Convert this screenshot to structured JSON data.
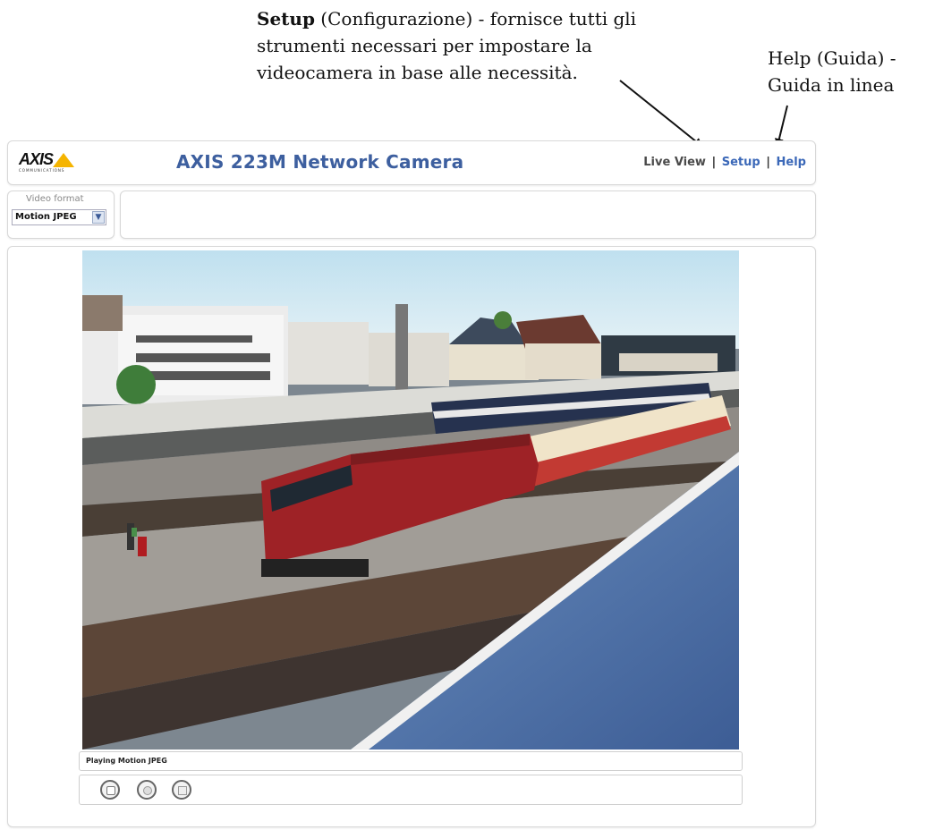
{
  "annotations": {
    "setup_bold": "Setup",
    "setup_rest": " (Configurazione) - fornisce tutti gli",
    "setup_line2": "strumenti necessari per impostare la",
    "setup_line3": "videocamera in base alle necessità.",
    "help_line1": "Help (Guida) -",
    "help_line2": "Guida in linea"
  },
  "header": {
    "logo_text": "AXIS",
    "logo_tagline": "COMMUNICATIONS",
    "title": "AXIS 223M Network Camera",
    "nav": {
      "live_view": "Live View",
      "setup": "Setup",
      "help": "Help",
      "separator": "|"
    }
  },
  "video_format": {
    "label": "Video format",
    "selected": "Motion JPEG"
  },
  "video": {
    "status": "Playing Motion JPEG"
  },
  "controls": {
    "icons": [
      "stop-icon",
      "snapshot-icon",
      "fullscreen-icon"
    ]
  },
  "colors": {
    "title_blue": "#3d5f9f",
    "link_blue": "#3b68b8",
    "logo_yellow": "#f5b400"
  }
}
